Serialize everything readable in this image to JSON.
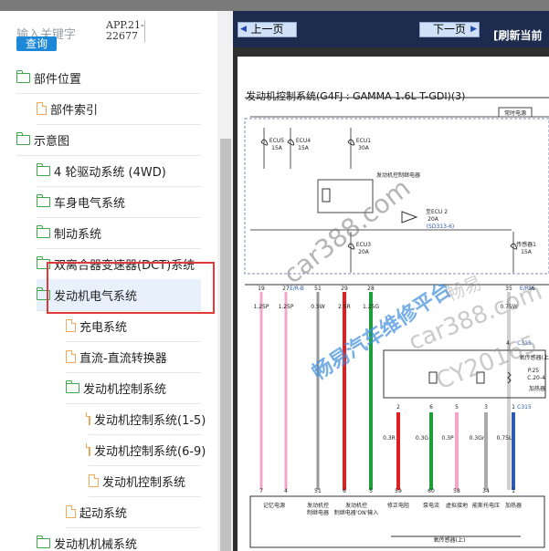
{
  "search": {
    "placeholder": "输入关键字",
    "button_label": "查询",
    "result_code": "APP.21-22677"
  },
  "tree": [
    {
      "label": "部件位置",
      "type": "folder",
      "level": 0
    },
    {
      "label": "部件索引",
      "type": "doc",
      "level": 1
    },
    {
      "label": "示意图",
      "type": "folder",
      "level": 0
    },
    {
      "label": "4 轮驱动系统 (4WD)",
      "type": "folder",
      "level": 1
    },
    {
      "label": "车身电气系统",
      "type": "folder",
      "level": 1
    },
    {
      "label": "制动系统",
      "type": "folder",
      "level": 1
    },
    {
      "label": "双离合器变速器(DCT)系统",
      "type": "folder",
      "level": 1
    },
    {
      "label": "发动机电气系统",
      "type": "folder",
      "level": 1,
      "selected": true
    },
    {
      "label": "充电系统",
      "type": "doc",
      "level": 2
    },
    {
      "label": "直流-直流转换器",
      "type": "doc",
      "level": 2
    },
    {
      "label": "发动机控制系统",
      "type": "folder",
      "level": 2
    },
    {
      "label": "发动机控制系统(1-5)",
      "type": "doc",
      "level": 3
    },
    {
      "label": "发动机控制系统(6-9)",
      "type": "doc",
      "level": 3
    },
    {
      "label": "发动机控制系统",
      "type": "doc",
      "level": 3
    },
    {
      "label": "起动系统",
      "type": "doc",
      "level": 2
    },
    {
      "label": "发动机机械系统",
      "type": "folder",
      "level": 1
    }
  ],
  "viewer": {
    "prev_label": "上一页",
    "next_label": "下一页",
    "refresh_label": "[刷新当前"
  },
  "diagram": {
    "title": "发动机控制系统(G4FJ : GAMMA 1.6L T-GDI)(3)",
    "always_power": "常时电源",
    "fuses": [
      {
        "name": "ECU5",
        "rating": "15A"
      },
      {
        "name": "ECU4",
        "rating": "15A"
      },
      {
        "name": "ECU1",
        "rating": "30A"
      },
      {
        "name": "ECU3",
        "rating": "20A"
      },
      {
        "name": "传感器1",
        "rating": "15A"
      }
    ],
    "relay_label": "发动机控制继电器",
    "ecu2_label": "至ECU 2",
    "ecu2_rating": "20A",
    "ecu2_ref": "(SD313-6)",
    "pins_top": [
      "19",
      "27",
      "51",
      "29",
      "28",
      "35",
      "36"
    ],
    "conn_labels": [
      "E/R-B",
      "E/R-A"
    ],
    "wires": [
      "1.25P",
      "1.25P",
      "0.5W",
      "2.5R",
      "1.25G",
      "0.75W"
    ],
    "c315_pins": [
      "4",
      "1"
    ],
    "connector": "C315",
    "sensor_label": "氧传感器(上)",
    "heater_label": "加热器",
    "sensor_ref": [
      "P.25",
      "C.20-4"
    ],
    "sensor_pins": [
      "2",
      "6",
      "5",
      "3",
      "1"
    ],
    "sensor_wires": [
      "0.3R",
      "0.3G",
      "0.3P",
      "0.3Gr",
      "0.75L"
    ],
    "bottom_pins": [
      "7",
      "4",
      "51",
      "6",
      "5",
      "59",
      "60",
      "58",
      "34",
      "1"
    ],
    "bottom_labels": [
      "记忆电源",
      "发动机控制继电器",
      "发动机控制继电器'ON'输入",
      "修正电阻",
      "泵电流",
      "虚拟接地",
      "能斯托电压",
      "加热器"
    ],
    "module_label": "氧传感器(上)"
  },
  "watermarks": {
    "site": "car388.com",
    "red_text": "畅易汽车维修平台",
    "gray_text": "car388.com",
    "gray_code": "CY20165",
    "brand": "畅易"
  }
}
